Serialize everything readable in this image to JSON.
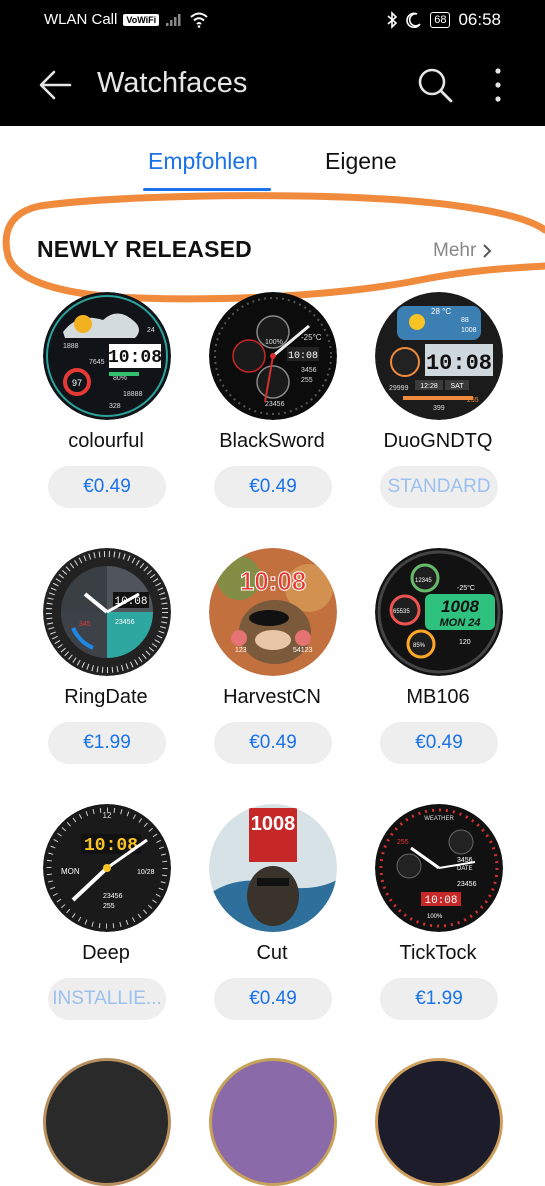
{
  "status_bar": {
    "carrier": "WLAN Call",
    "vowifi": "VoWiFi",
    "battery": "68",
    "time": "06:58"
  },
  "app_bar": {
    "title": "Watchfaces"
  },
  "tabs": [
    {
      "label": "Empfohlen",
      "active": true
    },
    {
      "label": "Eigene",
      "active": false
    }
  ],
  "section": {
    "title": "NEWLY RELEASED",
    "more_label": "Mehr"
  },
  "accent_color": "#1a73e8",
  "watchfaces": [
    {
      "name": "colourful",
      "action": "€0.49"
    },
    {
      "name": "BlackSword",
      "action": "€0.49"
    },
    {
      "name": "DuoGNDTQ",
      "action": "STANDARD"
    },
    {
      "name": "RingDate",
      "action": "€1.99"
    },
    {
      "name": "HarvestCN",
      "action": "€0.49"
    },
    {
      "name": "MB106",
      "action": "€0.49"
    },
    {
      "name": "Deep",
      "action": "INSTALLIE..."
    },
    {
      "name": "Cut",
      "action": "€0.49"
    },
    {
      "name": "TickTock",
      "action": "€1.99"
    }
  ],
  "faces": {
    "colourful": {
      "time": "10:08",
      "a": "7645",
      "b": "80%",
      "c": "18888",
      "d": "328",
      "e": "97",
      "f": "1888",
      "g": "24"
    },
    "blacksword": {
      "time": "10:08",
      "temp": "-25°C",
      "a": "3456",
      "b": "255",
      "c": "23456",
      "d": "100%",
      "date": "25"
    },
    "duo": {
      "time": "10:08",
      "temp": "28 °C",
      "a": "88",
      "b": "1008",
      "c": "29999",
      "d": "12:28",
      "day": "SAT",
      "e": "399",
      "f": "255"
    },
    "ringdate": {
      "time": "10:08",
      "a": "23456",
      "b": "345"
    },
    "harvest": {
      "time": "10:08",
      "a": "123",
      "b": "54123"
    },
    "mb106": {
      "time": "1008",
      "date": "MON 24",
      "a": "12345",
      "b": "65535",
      "c": "85%",
      "d": "120",
      "temp": "-25°C"
    },
    "deep": {
      "time": "10:08",
      "day": "MON",
      "date": "10/28",
      "a": "23456",
      "b": "255",
      "c": "12"
    },
    "cut": {
      "time": "1008"
    },
    "ticktock": {
      "time": "10:08",
      "a": "3456",
      "b": "23456",
      "c": "255",
      "d": "100%",
      "label": "WEATHER",
      "date": "DATE"
    }
  }
}
